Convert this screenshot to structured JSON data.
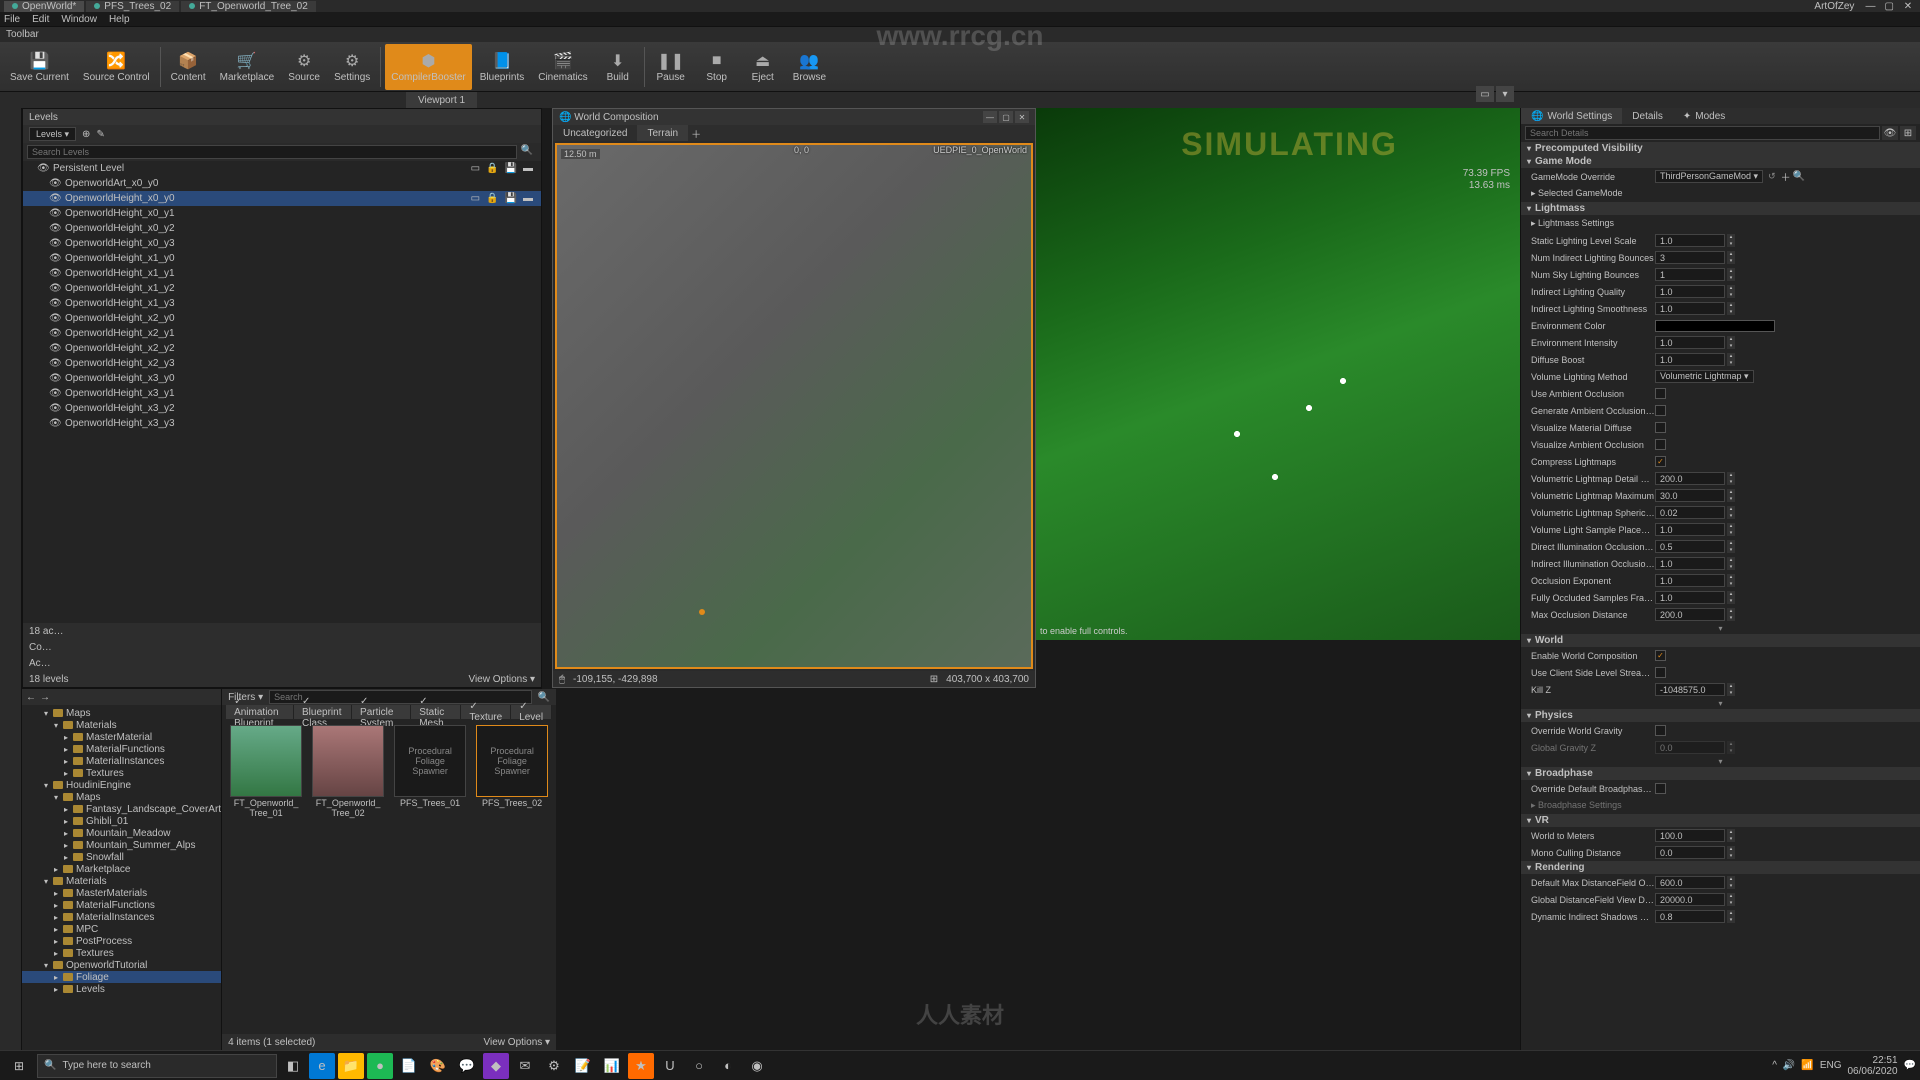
{
  "titlebar": {
    "tabs": [
      "OpenWorld*",
      "PFS_Trees_02",
      "FT_Openworld_Tree_02"
    ],
    "right": "ArtOfZey"
  },
  "menu": [
    "File",
    "Edit",
    "Window",
    "Help"
  ],
  "toolbar_label": "Toolbar",
  "toolbar": [
    {
      "label": "Save Current",
      "icon": "💾"
    },
    {
      "label": "Source Control",
      "icon": "🔀"
    },
    {
      "label": "Content",
      "icon": "📦"
    },
    {
      "label": "Marketplace",
      "icon": "🛒"
    },
    {
      "label": "Source",
      "icon": "⚙"
    },
    {
      "label": "Settings",
      "icon": "⚙"
    },
    {
      "label": "CompilerBooster",
      "icon": "⬢",
      "active": true
    },
    {
      "label": "Blueprints",
      "icon": "📘"
    },
    {
      "label": "Cinematics",
      "icon": "🎬"
    },
    {
      "label": "Build",
      "icon": "⬇"
    },
    {
      "label": "Pause",
      "icon": "❚❚"
    },
    {
      "label": "Stop",
      "icon": "■"
    },
    {
      "label": "Eject",
      "icon": "⏏"
    },
    {
      "label": "Browse",
      "icon": "👥"
    }
  ],
  "subtabs": {
    "left": "",
    "viewport": "Viewport 1"
  },
  "levels": {
    "title": "Levels",
    "dropdown": "Levels ▾",
    "search_ph": "Search Levels",
    "items": [
      {
        "name": "Persistent Level",
        "persistent": true,
        "icons": true
      },
      {
        "name": "OpenworldArt_x0_y0"
      },
      {
        "name": "OpenworldHeight_x0_y0",
        "selected": true,
        "icons": true
      },
      {
        "name": "OpenworldHeight_x0_y1"
      },
      {
        "name": "OpenworldHeight_x0_y2"
      },
      {
        "name": "OpenworldHeight_x0_y3"
      },
      {
        "name": "OpenworldHeight_x1_y0"
      },
      {
        "name": "OpenworldHeight_x1_y1"
      },
      {
        "name": "OpenworldHeight_x1_y2"
      },
      {
        "name": "OpenworldHeight_x1_y3"
      },
      {
        "name": "OpenworldHeight_x2_y0"
      },
      {
        "name": "OpenworldHeight_x2_y1"
      },
      {
        "name": "OpenworldHeight_x2_y2"
      },
      {
        "name": "OpenworldHeight_x2_y3"
      },
      {
        "name": "OpenworldHeight_x3_y0"
      },
      {
        "name": "OpenworldHeight_x3_y1"
      },
      {
        "name": "OpenworldHeight_x3_y2"
      },
      {
        "name": "OpenworldHeight_x3_y3"
      }
    ],
    "status": "18 levels",
    "actor_status": "18 ac…",
    "co_status": "Co…",
    "ac_status": "Ac…"
  },
  "wc": {
    "title": "World Composition",
    "tabs": [
      "Uncategorized",
      "Terrain"
    ],
    "scale": "12.50 m",
    "origin": "0, 0",
    "pie": "UEDPIE_0_OpenWorld",
    "coords": "-109,155, -429,898",
    "size": "403,700 x 403,700",
    "view": "View Options ▾"
  },
  "viewport": {
    "sim": "SIMULATING",
    "fps1": "73.39 FPS",
    "fps2": "13.63 ms",
    "hint": "to enable full controls."
  },
  "cb": {
    "filters_label": "Filters ▾",
    "search_ph": "Search",
    "filter_tabs": [
      "Animation Blueprint",
      "Blueprint Class",
      "Particle System",
      "Static Mesh",
      "Texture",
      "Level"
    ],
    "tree": [
      {
        "d": 2,
        "n": "Maps",
        "open": true
      },
      {
        "d": 3,
        "n": "Materials",
        "open": true
      },
      {
        "d": 4,
        "n": "MasterMaterial"
      },
      {
        "d": 4,
        "n": "MaterialFunctions"
      },
      {
        "d": 4,
        "n": "MaterialInstances"
      },
      {
        "d": 4,
        "n": "Textures"
      },
      {
        "d": 2,
        "n": "HoudiniEngine",
        "open": true
      },
      {
        "d": 3,
        "n": "Maps",
        "open": true
      },
      {
        "d": 4,
        "n": "Fantasy_Landscape_CoverArt"
      },
      {
        "d": 4,
        "n": "Ghibli_01"
      },
      {
        "d": 4,
        "n": "Mountain_Meadow"
      },
      {
        "d": 4,
        "n": "Mountain_Summer_Alps"
      },
      {
        "d": 4,
        "n": "Snowfall"
      },
      {
        "d": 3,
        "n": "Marketplace"
      },
      {
        "d": 2,
        "n": "Materials",
        "open": true
      },
      {
        "d": 3,
        "n": "MasterMaterials"
      },
      {
        "d": 3,
        "n": "MaterialFunctions"
      },
      {
        "d": 3,
        "n": "MaterialInstances"
      },
      {
        "d": 3,
        "n": "MPC"
      },
      {
        "d": 3,
        "n": "PostProcess"
      },
      {
        "d": 3,
        "n": "Textures"
      },
      {
        "d": 2,
        "n": "OpenworldTutorial",
        "open": true,
        "sel": false
      },
      {
        "d": 3,
        "n": "Foliage",
        "sel": true
      },
      {
        "d": 3,
        "n": "Levels"
      }
    ],
    "assets": [
      {
        "name": "FT_Openworld_Tree_01",
        "cls": "tree1"
      },
      {
        "name": "FT_Openworld_Tree_02",
        "cls": "tree2"
      },
      {
        "name": "PFS_Trees_01",
        "text": "Procedural Foliage Spawner"
      },
      {
        "name": "PFS_Trees_02",
        "text": "Procedural Foliage Spawner",
        "sel": true
      }
    ],
    "status_left": "4 items (1 selected)",
    "status_right": "View Options ▾"
  },
  "right": {
    "tabs": [
      "World Settings",
      "Details",
      "Modes"
    ],
    "search_ph": "Search Details",
    "sections": [
      {
        "cat": "Precomputed Visibility"
      },
      {
        "cat": "Game Mode",
        "rows": [
          {
            "l": "GameMode Override",
            "select": "ThirdPersonGameMod",
            "extra": true
          },
          {
            "l": "Selected GameMode",
            "arrow": true
          }
        ]
      },
      {
        "cat": "Lightmass",
        "rows": [
          {
            "l": "Lightmass Settings",
            "arrow": true,
            "sub": true
          }
        ]
      },
      {
        "rows": [
          {
            "l": "Static Lighting Level Scale",
            "v": "1.0",
            "spin": true
          },
          {
            "l": "Num Indirect Lighting Bounces",
            "v": "3",
            "spin": true
          },
          {
            "l": "Num Sky Lighting Bounces",
            "v": "1",
            "spin": true
          },
          {
            "l": "Indirect Lighting Quality",
            "v": "1.0",
            "spin": true
          },
          {
            "l": "Indirect Lighting Smoothness",
            "v": "1.0",
            "spin": true
          },
          {
            "l": "Environment Color",
            "color": "#000000"
          },
          {
            "l": "Environment Intensity",
            "v": "1.0",
            "spin": true
          },
          {
            "l": "Diffuse Boost",
            "v": "1.0",
            "spin": true
          },
          {
            "l": "Volume Lighting Method",
            "select": "Volumetric Lightmap"
          },
          {
            "l": "Use Ambient Occlusion",
            "check": false
          },
          {
            "l": "Generate Ambient Occlusion Mat",
            "check": false
          },
          {
            "l": "Visualize Material Diffuse",
            "check": false
          },
          {
            "l": "Visualize Ambient Occlusion",
            "check": false
          },
          {
            "l": "Compress Lightmaps",
            "check": true
          },
          {
            "l": "Volumetric Lightmap Detail Cell",
            "v": "200.0",
            "spin": true
          },
          {
            "l": "Volumetric Lightmap Maximum",
            "v": "30.0",
            "spin": true
          },
          {
            "l": "Volumetric Lightmap Spherical H",
            "v": "0.02",
            "spin": true
          },
          {
            "l": "Volume Light Sample Placement",
            "v": "1.0",
            "spin": true
          },
          {
            "l": "Direct Illumination Occlusion Fra",
            "v": "0.5",
            "spin": true
          },
          {
            "l": "Indirect Illumination Occlusion F",
            "v": "1.0",
            "spin": true
          },
          {
            "l": "Occlusion Exponent",
            "v": "1.0",
            "spin": true
          },
          {
            "l": "Fully Occluded Samples Fraction",
            "v": "1.0",
            "spin": true
          },
          {
            "l": "Max Occlusion Distance",
            "v": "200.0",
            "spin": true
          }
        ],
        "expand": true
      },
      {
        "cat": "World",
        "rows": [
          {
            "l": "Enable World Composition",
            "check": true
          },
          {
            "l": "Use Client Side Level Streaming Vo",
            "check": false
          },
          {
            "l": "Kill Z",
            "v": "-1048575.0",
            "spin": true
          }
        ],
        "expand": true
      },
      {
        "cat": "Physics",
        "rows": [
          {
            "l": "Override World Gravity",
            "check": false
          },
          {
            "l": "Global Gravity Z",
            "v": "0.0",
            "spin": true,
            "dim": true
          }
        ],
        "expand": true
      },
      {
        "cat": "Broadphase",
        "rows": [
          {
            "l": "Override Default Broadphase Setti",
            "check": false
          },
          {
            "l": "Broadphase Settings",
            "arrow": true,
            "dim": true
          }
        ]
      },
      {
        "cat": "VR",
        "rows": [
          {
            "l": "World to Meters",
            "v": "100.0",
            "spin": true
          },
          {
            "l": "Mono Culling Distance",
            "v": "0.0",
            "spin": true
          }
        ]
      },
      {
        "cat": "Rendering",
        "rows": [
          {
            "l": "Default Max DistanceField Occlusi",
            "v": "600.0",
            "spin": true
          },
          {
            "l": "Global DistanceField View Distanc",
            "v": "20000.0",
            "spin": true
          },
          {
            "l": "Dynamic Indirect Shadows Self Sh",
            "v": "0.8",
            "spin": true
          }
        ]
      }
    ]
  },
  "taskbar": {
    "search": "Type here to search",
    "tray": [
      "^",
      "🔊",
      "📶",
      "ENG"
    ],
    "time": "22:51",
    "date": "06/06/2020"
  },
  "watermark_url": "www.rrcg.cn",
  "watermark_cn": "人人素材"
}
